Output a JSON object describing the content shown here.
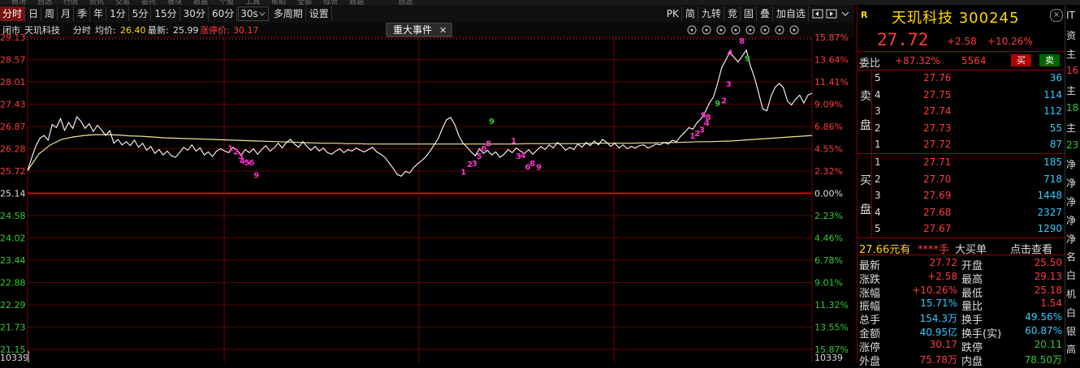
{
  "menu": [
    "商场",
    "自选",
    "行情",
    "资讯",
    "交易",
    "委托",
    "板块",
    "数据",
    "个股",
    "工具",
    "帮助",
    "全部",
    "综合",
    "数据",
    "",
    "",
    "自选"
  ],
  "toolbar": {
    "period_buttons": [
      "分时",
      "日",
      "周",
      "月",
      "季",
      "年",
      "1分",
      "5分",
      "15分",
      "30分",
      "60分"
    ],
    "interval_value": "30s",
    "extra_buttons": [
      "多周期",
      "设置"
    ],
    "right_buttons": [
      "PK",
      "简",
      "九转",
      "竞",
      "固",
      "叠",
      "加自选"
    ]
  },
  "chart": {
    "header": {
      "item1": "闭市",
      "stock": "天玑科技",
      "mode": "分时",
      "avg_label": "均价:",
      "avg_value": "26.40",
      "latest_label": "最新:",
      "latest_value": "25.99",
      "limit_label": "涨停价:",
      "limit_value": "30.17"
    },
    "event_tab": "重大事件",
    "event_close": "✕",
    "price_labels": [
      "29.13",
      "28.57",
      "28.01",
      "27.43",
      "26.87",
      "26.28",
      "25.72",
      "25.14",
      "24.58",
      "24.02",
      "23.44",
      "22.88",
      "22.29",
      "21.73",
      "21.15",
      "10339"
    ],
    "pct_labels": [
      "15.87%",
      "13.64%",
      "11.41%",
      "9.09%",
      "6.86%",
      "4.55%",
      "2.32%",
      "0.00%",
      "2.23%",
      "4.46%",
      "6.78%",
      "9.01%",
      "11.32%",
      "13.55%",
      "15.87%",
      "10339"
    ],
    "price_line": [
      25.72,
      26.05,
      26.35,
      26.55,
      26.62,
      26.5,
      26.9,
      26.82,
      27.05,
      26.75,
      26.95,
      26.8,
      27.1,
      26.98,
      26.8,
      26.92,
      26.72,
      26.88,
      26.76,
      26.62,
      26.74,
      26.42,
      26.52,
      26.38,
      26.46,
      26.36,
      26.5,
      26.32,
      26.42,
      26.24,
      26.34,
      26.16,
      26.26,
      26.12,
      26.22,
      26.1,
      26.06,
      26.18,
      26.32,
      26.24,
      26.38,
      26.22,
      26.3,
      26.12,
      26.2,
      26.08,
      26.22,
      26.28,
      26.22,
      26.18,
      26.32,
      26.24,
      26.12,
      26.26,
      26.18,
      26.28,
      26.14,
      26.26,
      26.36,
      26.22,
      26.3,
      26.42,
      26.3,
      26.44,
      26.52,
      26.4,
      26.32,
      26.46,
      26.34,
      26.24,
      26.34,
      26.22,
      26.3,
      26.18,
      26.14,
      26.22,
      26.28,
      26.18,
      26.26,
      26.22,
      26.3,
      26.24,
      26.2,
      26.26,
      26.32,
      26.2,
      26.14,
      26.06,
      25.92,
      25.78,
      25.62,
      25.58,
      25.7,
      25.66,
      25.8,
      25.9,
      25.98,
      26.08,
      26.22,
      26.38,
      26.55,
      26.8,
      27.02,
      27.08,
      26.9,
      26.62,
      26.42,
      26.32,
      26.2,
      26.1,
      26.28,
      26.16,
      26.24,
      26.12,
      26.2,
      26.06,
      26.14,
      26.26,
      26.18,
      26.3,
      26.22,
      26.16,
      26.26,
      26.14,
      26.24,
      26.34,
      26.26,
      26.38,
      26.3,
      26.44,
      26.36,
      26.24,
      26.32,
      26.26,
      26.4,
      26.32,
      26.44,
      26.36,
      26.48,
      26.38,
      26.52,
      26.44,
      26.34,
      26.42,
      26.3,
      26.38,
      26.28,
      26.34,
      26.3,
      26.36,
      26.38,
      26.3,
      26.34,
      26.4,
      26.38,
      26.44,
      26.4,
      26.5,
      26.46,
      26.6,
      26.7,
      26.82,
      26.78,
      26.95,
      27.05,
      27.22,
      27.45,
      27.6,
      27.95,
      28.35,
      28.55,
      28.75,
      28.62,
      28.5,
      28.65,
      28.8,
      28.4,
      28.1,
      27.7,
      27.3,
      27.25,
      27.62,
      27.85,
      27.95,
      27.85,
      27.5,
      27.4,
      27.55,
      27.65,
      27.45,
      27.65,
      27.7
    ],
    "avg_line": [
      25.72,
      26.15,
      26.38,
      26.52,
      26.58,
      26.62,
      26.64,
      26.64,
      26.63,
      26.61,
      26.6,
      26.58,
      26.56,
      26.55,
      26.54,
      26.53,
      26.52,
      26.51,
      26.5,
      26.49,
      26.48,
      26.47,
      26.46,
      26.45,
      26.44,
      26.43,
      26.42,
      26.42,
      26.41,
      26.41,
      26.4,
      26.4,
      26.4,
      26.4,
      26.4,
      26.4,
      26.4,
      26.4,
      26.4,
      26.4,
      26.4,
      26.4,
      26.4,
      26.4,
      26.41,
      26.41,
      26.41,
      26.41,
      26.41,
      26.41,
      26.42,
      26.42,
      26.42,
      26.42,
      26.43,
      26.43,
      26.44,
      26.44,
      26.45,
      26.46,
      26.46,
      26.47,
      26.48,
      26.5,
      26.52,
      26.54,
      26.56,
      26.58,
      26.6,
      26.62
    ],
    "markers": [
      {
        "text": "1",
        "x": 0.255,
        "price": 26.3,
        "color": "#ff33cc"
      },
      {
        "text": "2",
        "x": 0.262,
        "price": 26.22,
        "color": "#ff33cc"
      },
      {
        "text": "3",
        "x": 0.268,
        "price": 26.1,
        "color": "#ff33cc"
      },
      {
        "text": "4",
        "x": 0.27,
        "price": 25.98,
        "color": "#ff33cc"
      },
      {
        "text": "5",
        "x": 0.276,
        "price": 25.94,
        "color": "#ff33cc"
      },
      {
        "text": "6",
        "x": 0.282,
        "price": 25.94,
        "color": "#ff33cc"
      },
      {
        "text": "9",
        "x": 0.288,
        "price": 25.62,
        "color": "#ff33cc"
      },
      {
        "text": "1",
        "x": 0.552,
        "price": 25.7,
        "color": "#ff33cc"
      },
      {
        "text": "2",
        "x": 0.56,
        "price": 25.9,
        "color": "#ff33cc"
      },
      {
        "text": "3",
        "x": 0.566,
        "price": 25.92,
        "color": "#ff33cc"
      },
      {
        "text": "5",
        "x": 0.572,
        "price": 26.1,
        "color": "#ff33cc"
      },
      {
        "text": "6",
        "x": 0.578,
        "price": 26.3,
        "color": "#ff33cc"
      },
      {
        "text": "8",
        "x": 0.584,
        "price": 26.42,
        "color": "#ff33cc"
      },
      {
        "text": "9",
        "x": 0.588,
        "price": 27.0,
        "color": "#33cc33"
      },
      {
        "text": "1",
        "x": 0.616,
        "price": 26.5,
        "color": "#ff33cc"
      },
      {
        "text": "3",
        "x": 0.622,
        "price": 26.1,
        "color": "#ff33cc"
      },
      {
        "text": "4",
        "x": 0.628,
        "price": 26.12,
        "color": "#ff33cc"
      },
      {
        "text": "6",
        "x": 0.634,
        "price": 25.82,
        "color": "#ff33cc"
      },
      {
        "text": "8",
        "x": 0.64,
        "price": 25.92,
        "color": "#ff33cc"
      },
      {
        "text": "9",
        "x": 0.648,
        "price": 25.82,
        "color": "#ff33cc"
      },
      {
        "text": "1",
        "x": 0.844,
        "price": 26.62,
        "color": "#ff33cc"
      },
      {
        "text": "2",
        "x": 0.85,
        "price": 26.68,
        "color": "#ff33cc"
      },
      {
        "text": "3",
        "x": 0.856,
        "price": 26.78,
        "color": "#ff33cc"
      },
      {
        "text": "4",
        "x": 0.862,
        "price": 26.95,
        "color": "#ff33cc"
      },
      {
        "text": "5",
        "x": 0.858,
        "price": 27.15,
        "color": "#ff33cc"
      },
      {
        "text": "8",
        "x": 0.864,
        "price": 27.1,
        "color": "#ff33cc"
      },
      {
        "text": "9",
        "x": 0.876,
        "price": 27.45,
        "color": "#33cc33"
      },
      {
        "text": "2",
        "x": 0.884,
        "price": 27.52,
        "color": "#ff33cc"
      },
      {
        "text": "3",
        "x": 0.89,
        "price": 27.95,
        "color": "#ff33cc"
      },
      {
        "text": "4",
        "x": 0.892,
        "price": 28.75,
        "color": "#ff33cc"
      },
      {
        "text": "8",
        "x": 0.907,
        "price": 29.05,
        "color": "#ff33cc"
      },
      {
        "text": "9",
        "x": 0.914,
        "price": 28.6,
        "color": "#33cc33"
      }
    ]
  },
  "quote": {
    "name": "天玑科技",
    "code": "300245",
    "r_tag": "R",
    "close_icon": "×",
    "price": "27.72",
    "change": "+2.58",
    "change_pct": "+10.26%",
    "weibi_label": "委比",
    "weibi_value": "+87.32%",
    "weibi_vol": "5564",
    "buy_btn": "买",
    "sell_btn": "卖",
    "sell_side_label": [
      "卖",
      "盘"
    ],
    "buy_side_label": [
      "买",
      "盘"
    ],
    "asks": [
      {
        "n": "5",
        "price": "27.76",
        "vol": "36"
      },
      {
        "n": "4",
        "price": "27.75",
        "vol": "114"
      },
      {
        "n": "3",
        "price": "27.74",
        "vol": "112"
      },
      {
        "n": "2",
        "price": "27.73",
        "vol": "55"
      },
      {
        "n": "1",
        "price": "27.72",
        "vol": "87"
      }
    ],
    "bids": [
      {
        "n": "1",
        "price": "27.71",
        "vol": "185"
      },
      {
        "n": "2",
        "price": "27.70",
        "vol": "718"
      },
      {
        "n": "3",
        "price": "27.69",
        "vol": "1448"
      },
      {
        "n": "4",
        "price": "27.68",
        "vol": "2327"
      },
      {
        "n": "5",
        "price": "27.67",
        "vol": "1290"
      }
    ],
    "trade_bar": {
      "price": "27.66元有",
      "stars": "****手",
      "big": "大买单",
      "click": "点击查看"
    },
    "stats": [
      {
        "l1": "最新",
        "v1": "27.72",
        "c1": "#ff3b3b",
        "l2": "开盘",
        "v2": "25.50",
        "c2": "#ff3b3b"
      },
      {
        "l1": "涨跌",
        "v1": "+2.58",
        "c1": "#ff3b3b",
        "l2": "最高",
        "v2": "29.13",
        "c2": "#ff3b3b"
      },
      {
        "l1": "涨幅",
        "v1": "+10.26%",
        "c1": "#ff3b3b",
        "l2": "最低",
        "v2": "25.18",
        "c2": "#ff3b3b"
      },
      {
        "l1": "振幅",
        "v1": "15.71%",
        "c1": "#33ccff",
        "l2": "量比",
        "v2": "1.54",
        "c2": "#ff3b3b"
      },
      {
        "l1": "总手",
        "v1": "154.3万",
        "c1": "#33ccff",
        "l2": "换手",
        "v2": "49.56%",
        "c2": "#33ccff"
      },
      {
        "l1": "金额",
        "v1": "40.95亿",
        "c1": "#33ccff",
        "l2": "换手(实)",
        "v2": "60.87%",
        "c2": "#33ccff"
      },
      {
        "l1": "涨停",
        "v1": "30.17",
        "c1": "#ff3b3b",
        "l2": "跌停",
        "v2": "20.11",
        "c2": "#33cc33"
      },
      {
        "l1": "外盘",
        "v1": "75.78万",
        "c1": "#ff3b3b",
        "l2": "内盘",
        "v2": "78.50万",
        "c2": "#33cc33"
      }
    ]
  },
  "edge": [
    {
      "t": "IT",
      "c": "#ddd"
    },
    {
      "t": "资",
      "c": "#ddd"
    },
    {
      "t": "主",
      "c": "#ddd"
    },
    {
      "t": "16",
      "c": "#ff3b3b"
    },
    {
      "t": "主",
      "c": "#ddd"
    },
    {
      "t": "18",
      "c": "#33cc33"
    },
    {
      "t": "主",
      "c": "#ddd"
    },
    {
      "t": "23",
      "c": "#33cc33"
    },
    {
      "t": "净",
      "c": "#ddd"
    },
    {
      "t": "净",
      "c": "#ddd"
    },
    {
      "t": "净",
      "c": "#ddd"
    },
    {
      "t": "净",
      "c": "#ddd"
    },
    {
      "t": "净",
      "c": "#ddd"
    },
    {
      "t": "名",
      "c": "#ddd"
    },
    {
      "t": "白",
      "c": "#ddd"
    },
    {
      "t": "机",
      "c": "#ddd"
    },
    {
      "t": "白",
      "c": "#ddd"
    },
    {
      "t": "银",
      "c": "#ddd"
    },
    {
      "t": "高",
      "c": "#ddd"
    }
  ]
}
